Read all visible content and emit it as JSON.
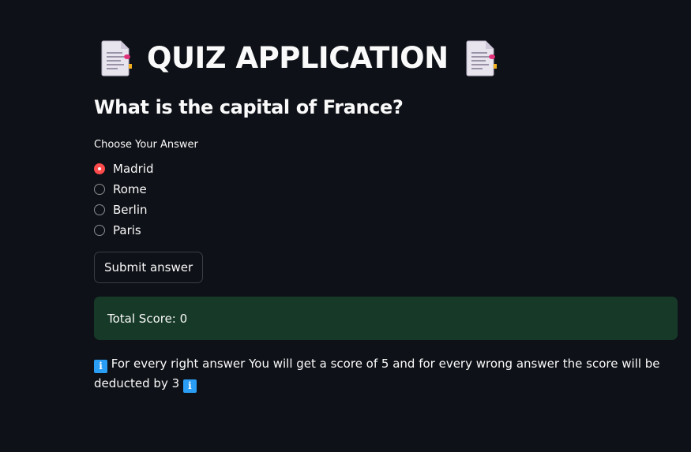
{
  "header": {
    "title": "QUIZ APPLICATION",
    "left_icon": "page-facing-up-icon",
    "right_icon": "page-facing-up-icon"
  },
  "quiz": {
    "question": "What is the capital of France?",
    "radio_label": "Choose Your Answer",
    "options": [
      {
        "label": "Madrid",
        "selected": true
      },
      {
        "label": "Rome",
        "selected": false
      },
      {
        "label": "Berlin",
        "selected": false
      },
      {
        "label": "Paris",
        "selected": false
      }
    ],
    "submit_label": "Submit answer"
  },
  "score": {
    "text": "Total Score: 0"
  },
  "info": {
    "icon": "information-icon",
    "icon_glyph": "i",
    "text": "For every right answer You will get a score of 5 and for every wrong answer the score will be deducted by 3"
  },
  "colors": {
    "background": "#0e1117",
    "accent": "#ff4b4b",
    "success_bg": "#173928",
    "info_icon": "#2a9df4"
  }
}
